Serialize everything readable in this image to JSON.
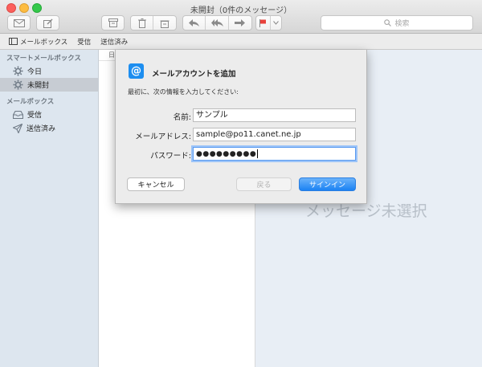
{
  "window": {
    "title": "未開封（0件のメッセージ）"
  },
  "toolbar": {
    "search_placeholder": "検索",
    "icons": [
      "compose-envelope-icon",
      "new-message-icon",
      "archive-icon",
      "trash-icon",
      "junk-icon",
      "reply-icon",
      "reply-all-icon",
      "forward-icon",
      "flag-icon",
      "chevron-down-icon",
      "search-icon"
    ],
    "flag_color": "#e8413b"
  },
  "favorites": {
    "mailboxes_label": "メールボックス",
    "inbox_label": "受信",
    "sent_label": "送信済み"
  },
  "sidebar": {
    "smart_header": "スマートメールボックス",
    "smart_items": [
      {
        "label": "今日",
        "icon": "gear-icon"
      },
      {
        "label": "未開封",
        "icon": "gear-icon",
        "selected": true
      }
    ],
    "mailbox_header": "メールボックス",
    "mailbox_items": [
      {
        "label": "受信",
        "icon": "inbox-tray-icon"
      },
      {
        "label": "送信済み",
        "icon": "paper-plane-icon"
      }
    ]
  },
  "message_list": {
    "sort_label": "日"
  },
  "viewer": {
    "empty_text": "メッセージ未選択"
  },
  "dialog": {
    "title": "メールアカウントを追加",
    "instructions": "最初に、次の情報を入力してください:",
    "fields": {
      "name_label": "名前:",
      "name_value": "サンプル",
      "email_label": "メールアドレス:",
      "email_value": "sample@po11.canet.ne.jp",
      "password_label": "パスワード:",
      "password_value": "●●●●●●●●●"
    },
    "buttons": {
      "cancel": "キャンセル",
      "back": "戻る",
      "sign_in": "サインイン"
    },
    "accent_color": "#1b82f3"
  }
}
